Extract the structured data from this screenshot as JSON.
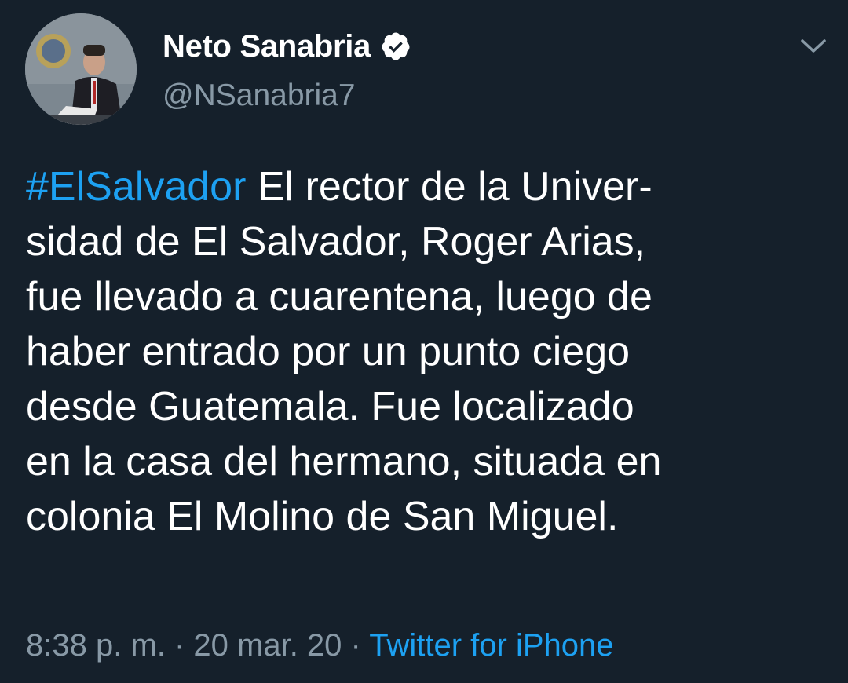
{
  "author": {
    "display_name": "Neto Sanabria",
    "handle": "@NSanabria7",
    "verified": true
  },
  "tweet": {
    "hashtag": "#ElSalvador",
    "line1_rest": " El rector de la Univer-",
    "lines": [
      "sidad de El Salvador, Roger Arias,",
      "fue llevado a cuarentena, luego de",
      "haber entrado por un punto ciego",
      "desde Guatemala. Fue localizado",
      "en la casa del hermano, situada en",
      "colonia El Molino de San Miguel."
    ]
  },
  "meta": {
    "time": "8:38 p. m.",
    "separator": " · ",
    "date": "20 mar. 20",
    "source": "Twitter for iPhone"
  },
  "colors": {
    "background": "#15202b",
    "link": "#1da1f2",
    "secondary_text": "#8899a6"
  },
  "icons": {
    "verified": "verified-badge-icon",
    "menu": "chevron-down-icon"
  }
}
